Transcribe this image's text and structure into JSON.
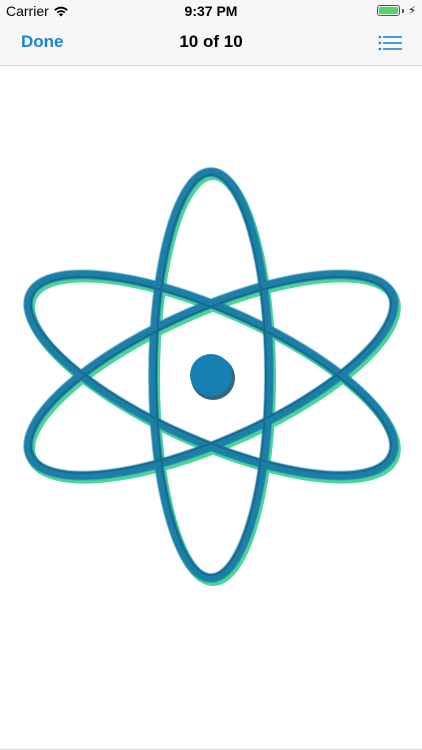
{
  "status_bar": {
    "carrier": "Carrier",
    "time": "9:37 PM",
    "wifi_icon": "wifi-icon",
    "battery_icon": "battery-icon",
    "charging_icon": "bolt-icon",
    "battery_color": "#4cd964"
  },
  "nav_bar": {
    "done_label": "Done",
    "title": "10 of 10",
    "list_icon": "list-icon",
    "accent_color": "#1b84d8"
  },
  "content": {
    "image_icon": "atom-icon",
    "atom_color": "#1a7fa8",
    "atom_highlight_color": "#3bd18e"
  }
}
